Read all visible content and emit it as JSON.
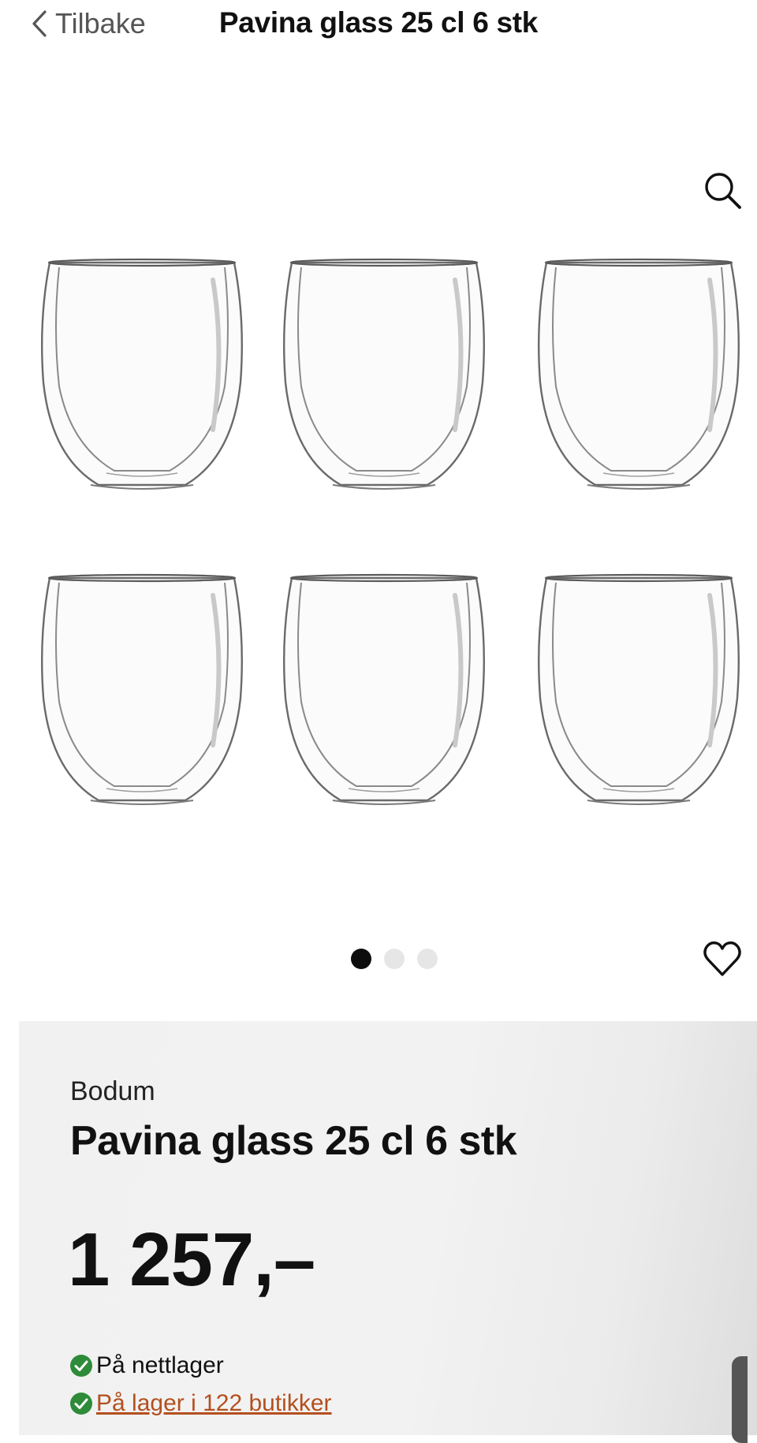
{
  "header": {
    "back_label": "Tilbake",
    "title": "Pavina glass 25 cl 6 stk"
  },
  "gallery": {
    "image_alt": "Pavina glass",
    "glass_count": 6,
    "dots": 3,
    "active_dot": 1
  },
  "product": {
    "brand": "Bodum",
    "name": "Pavina glass 25 cl 6 stk",
    "price": "1 257,–",
    "online_stock": "På nettlager",
    "store_stock": "På lager i 122 butikker"
  },
  "colors": {
    "accent_link": "#b3501f",
    "check_green": "#2e8b3a",
    "panel_bg": "#f2f2f2"
  },
  "icons": {
    "back": "chevron-left-icon",
    "zoom": "search-icon",
    "favorite": "heart-icon",
    "check": "check-circle-icon"
  }
}
